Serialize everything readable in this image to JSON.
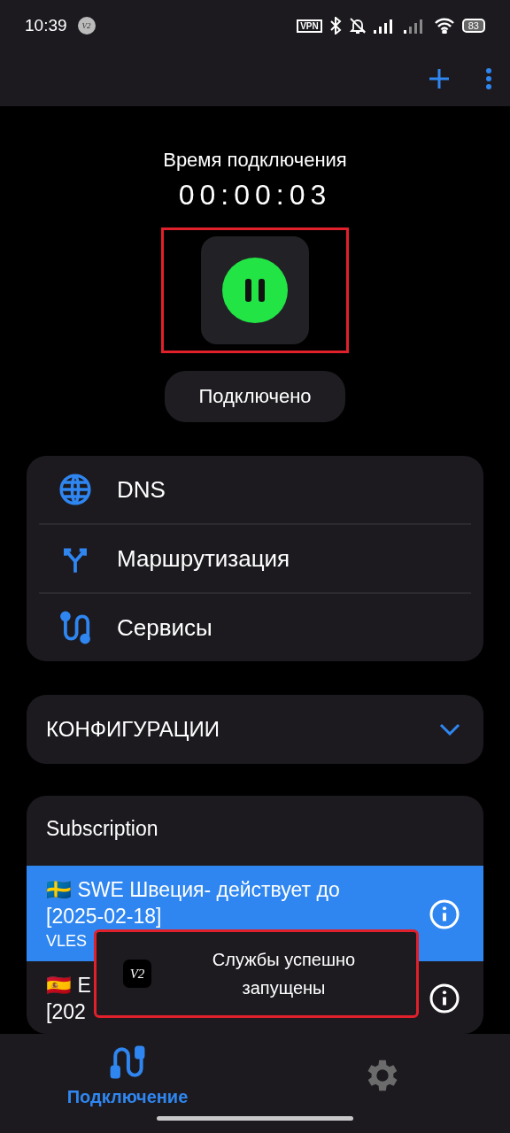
{
  "status_bar": {
    "time": "10:39",
    "app_badge": "V2",
    "vpn": "VPN",
    "battery": "83"
  },
  "timer": {
    "label": "Время подключения",
    "value": "00:00:03"
  },
  "connect_button": {
    "on": true
  },
  "status_chip": "Подключено",
  "menu": [
    {
      "kind": "globe",
      "label": "DNS"
    },
    {
      "kind": "routing",
      "label": "Маршрутизация"
    },
    {
      "kind": "services",
      "label": "Сервисы"
    }
  ],
  "configs": {
    "title": "КОНФИГУРАЦИИ",
    "expanded": true
  },
  "subscription": {
    "title": "Subscription",
    "servers": [
      {
        "lines": [
          "🇸🇪 SWE Швеция- действует до",
          "[2025-02-18]"
        ],
        "protocol": "VLES",
        "selected": true
      },
      {
        "lines": [
          "🇪🇸 E",
          "[202"
        ],
        "selected": false
      }
    ]
  },
  "toast": {
    "icon": "V2",
    "text": "Службы успешно запущены"
  },
  "nav": [
    {
      "kind": "connection",
      "label": "Подключение",
      "selected": true
    },
    {
      "kind": "settings",
      "selected": false
    }
  ]
}
